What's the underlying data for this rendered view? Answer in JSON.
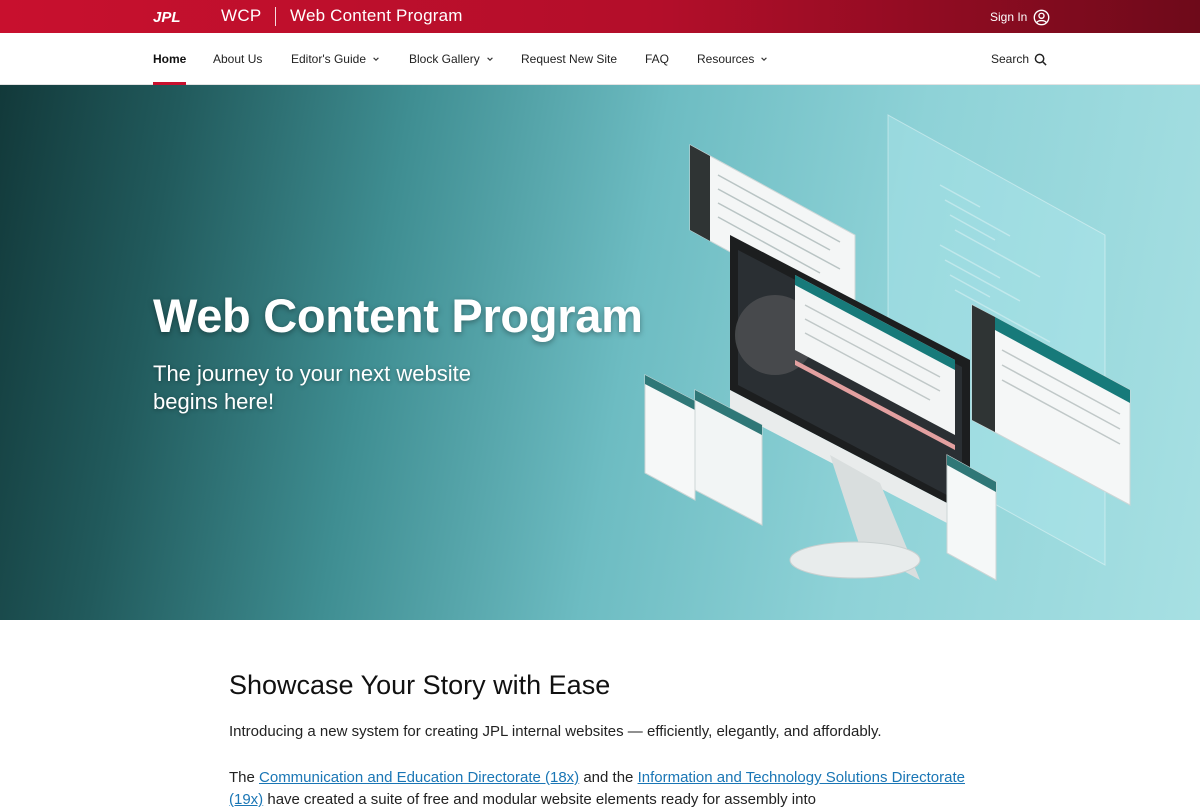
{
  "header": {
    "logo_text": "JPL",
    "site_abbr": "WCP",
    "site_name": "Web Content Program",
    "signin_label": "Sign In"
  },
  "nav": {
    "items": [
      {
        "label": "Home",
        "active": true,
        "dropdown": false
      },
      {
        "label": "About Us",
        "active": false,
        "dropdown": false
      },
      {
        "label": "Editor's Guide",
        "active": false,
        "dropdown": true
      },
      {
        "label": "Block Gallery",
        "active": false,
        "dropdown": true
      },
      {
        "label": "Request New Site",
        "active": false,
        "dropdown": false
      },
      {
        "label": "FAQ",
        "active": false,
        "dropdown": false
      },
      {
        "label": "Resources",
        "active": false,
        "dropdown": true
      }
    ],
    "search_label": "Search"
  },
  "hero": {
    "title": "Web Content Program",
    "subtitle": "The journey to your next website begins here!"
  },
  "main": {
    "heading": "Showcase Your Story with Ease",
    "intro": "Introducing a new system for creating JPL internal websites — efficiently, elegantly, and affordably.",
    "para_prefix": "The ",
    "link1": "Communication and Education Directorate (18x)",
    "para_mid": " and the ",
    "link2": "Information and Technology Solutions Directorate (19x)",
    "para_suffix": " have created a suite of free and modular website elements ready for assembly into"
  },
  "colors": {
    "brand_red": "#c8102e",
    "link_blue": "#1a76b5",
    "hero_teal_dark": "#12393a",
    "hero_teal_light": "#a7e0e3"
  },
  "icons": [
    "user-circle-icon",
    "chevron-down-icon",
    "search-icon"
  ]
}
